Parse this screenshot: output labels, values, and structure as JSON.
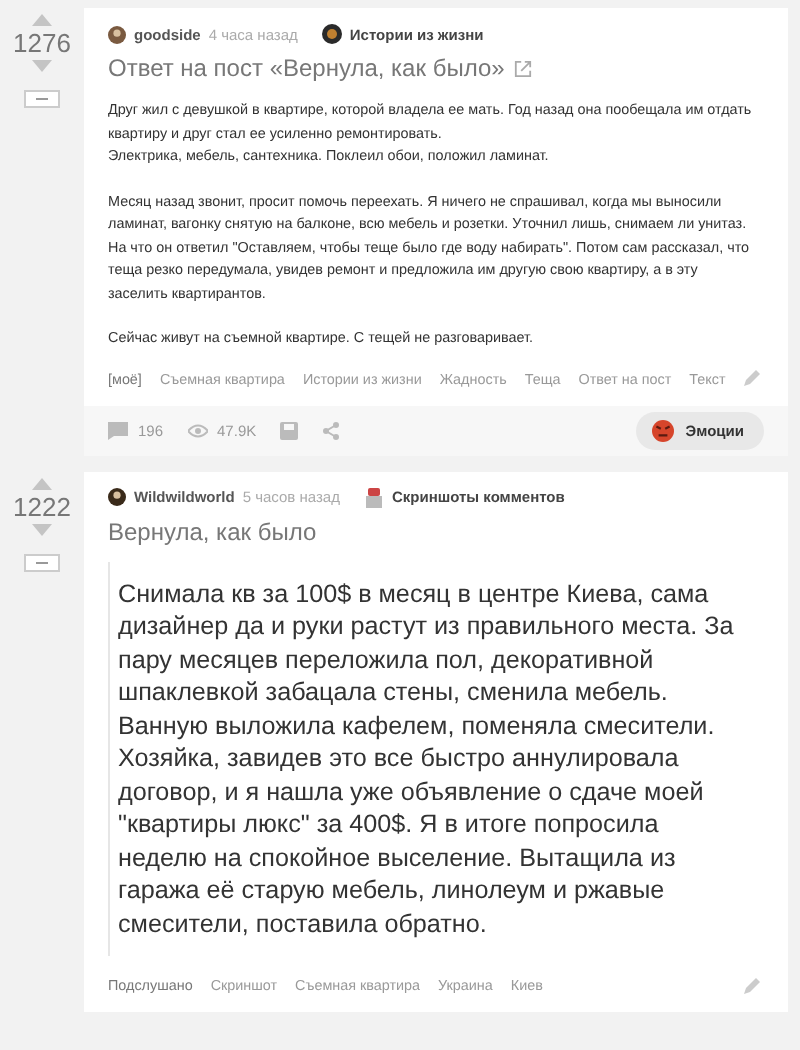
{
  "posts": [
    {
      "rating": "1276",
      "author": "goodside",
      "time": "4 часа назад",
      "community": "Истории из жизни",
      "title": "Ответ на пост «Вернула, как было»",
      "external_link": true,
      "paragraphs": [
        [
          "Друг жил с девушкой в квартире, которой владела ее мать. Год назад она пообещала им отдать квартиру и друг стал ее усиленно ремонтировать.",
          "Электрика, мебель, сантехника. Поклеил обои, положил ламинат."
        ],
        [
          "Месяц назад звонит, просит помочь переехать. Я ничего не спрашивал, когда мы выносили ламинат, вагонку снятую на балконе, всю мебель и розетки. Уточнил лишь, снимаем ли унитаз. На что он ответил \"Оставляем, чтобы теще было где воду набирать\". Потом сам рассказал, что теща резко передумала, увидев ремонт и предложила им другую свою квартиру, а в эту заселить квартирантов."
        ],
        [
          "Сейчас живут на съемной квартире. С тещей не разговаривает."
        ]
      ],
      "tags": [
        "[моё]",
        "Съемная квартира",
        "Истории из жизни",
        "Жадность",
        "Теща",
        "Ответ на пост",
        "Текст"
      ],
      "footer": {
        "comments": "196",
        "views": "47.9K",
        "emotions": "Эмоции"
      }
    },
    {
      "rating": "1222",
      "author": "Wildwildworld",
      "time": "5 часов назад",
      "community": "Скриншоты комментов",
      "title": "Вернула, как было",
      "external_link": false,
      "screenshot_lines": [
        "Снимала кв за 100$ в месяц в центре Киева, сама",
        "дизайнер да и руки растут из правильного места. За",
        "пару месяцев переложила пол, декоративной",
        "шпаклевкой забацала стены, сменила мебель.",
        "Ванную выложила кафелем, поменяла смесители.",
        "Хозяйка, завидев это все быстро аннулировала",
        "договор, и я нашла уже объявление о сдаче моей",
        "\"квартиры люкс\" за 400$. Я в итоге попросила",
        "неделю на спокойное выселение. Вытащила из",
        "гаража её старую мебель, линолеум и ржавые",
        "смесители, поставила обратно."
      ],
      "tags": [
        "Подслушано",
        "Скриншот",
        "Съемная квартира",
        "Украина",
        "Киев"
      ]
    }
  ]
}
